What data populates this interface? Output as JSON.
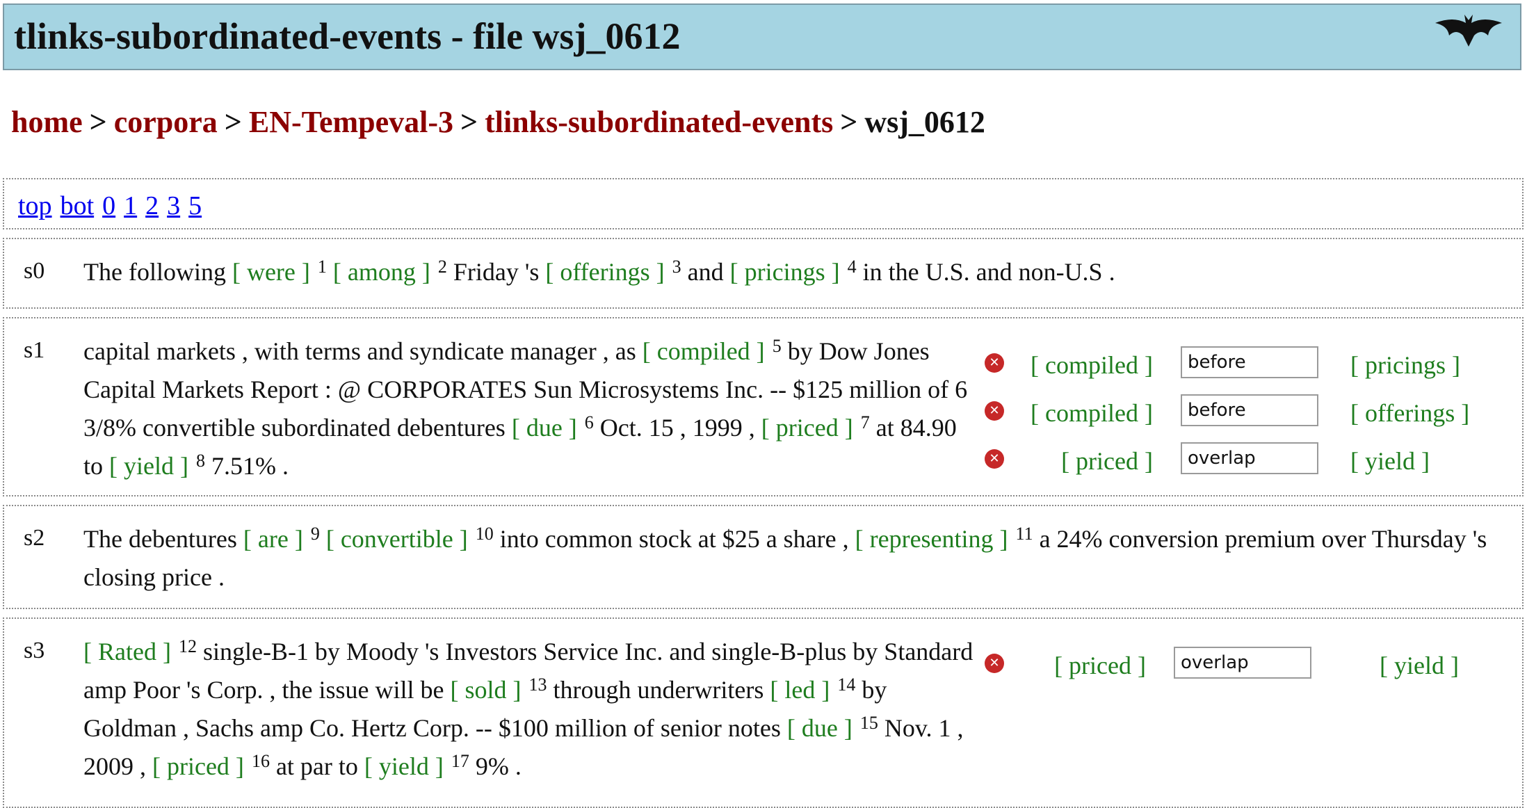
{
  "header": {
    "title": "tlinks-subordinated-events - file wsj_0612",
    "logo_icon": "bat-icon"
  },
  "breadcrumb": {
    "home": "home",
    "corpora": "corpora",
    "corpus": "EN-Tempeval-3",
    "task": "tlinks-subordinated-events",
    "file": "wsj_0612",
    "separator": ">"
  },
  "nav": {
    "top": "top",
    "bot": "bot",
    "n0": "0",
    "n1": "1",
    "n2": "2",
    "n3": "3",
    "n5": "5"
  },
  "sentences": {
    "s0": {
      "id": "s0",
      "t0": "The following ",
      "e1": "[ were ]",
      "n1": "1",
      "e2": "[ among ]",
      "n2": "2",
      "t1": " Friday 's ",
      "e3": "[ offerings ]",
      "n3": "3",
      "t2": " and ",
      "e4": "[ pricings ]",
      "n4": "4",
      "t3": " in the U.S. and non-U.S ."
    },
    "s1": {
      "id": "s1",
      "t0": "capital markets , with terms and syndicate manager , as ",
      "e5": "[ compiled ]",
      "n5": "5",
      "t1": " by Dow Jones Capital Markets Report : @ CORPORATES Sun Microsystems Inc. -- $125 million of 6 3/8% convertible subordinated debentures ",
      "e6": "[ due ]",
      "n6": "6",
      "t2": " Oct. 15 , 1999 , ",
      "e7": "[ priced ]",
      "n7": "7",
      "t3": " at 84.90 to ",
      "e8": "[ yield ]",
      "n8": "8",
      "t4": " 7.51% .",
      "tlinks": [
        {
          "source": "[ compiled ]",
          "relation": "before",
          "target": "[ pricings ]"
        },
        {
          "source": "[ compiled ]",
          "relation": "before",
          "target": "[ offerings ]"
        },
        {
          "source": "[ priced ]",
          "relation": "overlap",
          "target": "[ yield ]"
        }
      ]
    },
    "s2": {
      "id": "s2",
      "t0": "The debentures ",
      "e9": "[ are ]",
      "n9": "9",
      "t1": " ",
      "e10": "[ convertible ]",
      "n10": "10",
      "t2": " into common stock at $25 a share , ",
      "e11": "[ representing ]",
      "n11": "11",
      "t3": " a 24% conversion premium over Thursday 's closing price ."
    },
    "s3": {
      "id": "s3",
      "e12": "[ Rated ]",
      "n12": "12",
      "t0": " single-B-1 by Moody 's Investors Service Inc. and single-B-plus by Standard amp Poor 's Corp. , the issue will be ",
      "e13": "[ sold ]",
      "n13": "13",
      "t1": " through underwriters ",
      "e14": "[ led ]",
      "n14": "14",
      "t2": " by Goldman , Sachs amp Co. Hertz Corp. -- $100 million of senior notes ",
      "e15": "[ due ]",
      "n15": "15",
      "t3": " Nov. 1 , 2009 , ",
      "e16": "[ priced ]",
      "n16": "16",
      "t4": " at par to ",
      "e17": "[ yield ]",
      "n17": "17",
      "t5": " 9% .",
      "tlinks": [
        {
          "source": "[ priced ]",
          "relation": "overlap",
          "target": "[ yield ]"
        }
      ]
    }
  },
  "colors": {
    "header_bg": "#a5d4e2",
    "crumb_link": "#8b0000",
    "event": "#1e7d1e",
    "nav_link": "#0000ee",
    "delete": "#c62828"
  },
  "icons": {
    "delete": "x-circle-icon"
  }
}
